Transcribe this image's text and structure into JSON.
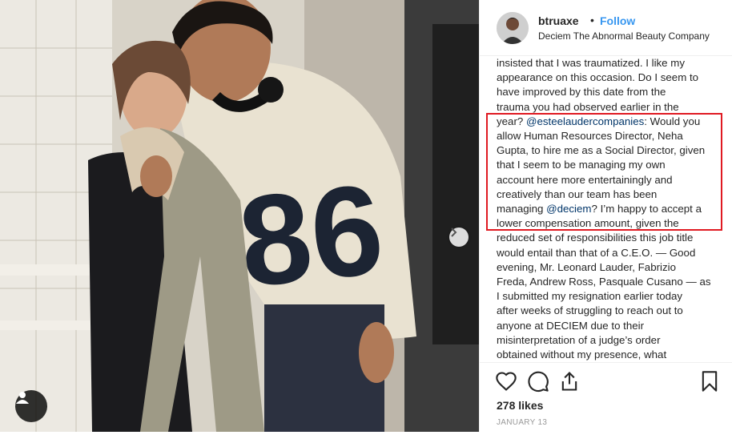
{
  "photo": {
    "alt_icons": {
      "next": "chevron-right-icon",
      "tag": "user-tag-icon"
    }
  },
  "header": {
    "username": "btruaxe",
    "separator": "•",
    "follow_label": "Follow",
    "location": "Deciem The Abnormal Beauty Company"
  },
  "caption": {
    "lines": [
      [
        {
          "t": "insisted that I was traumatized. I like my"
        }
      ],
      [
        {
          "t": "appearance on this occasion. Do I seem to"
        }
      ],
      [
        {
          "t": "have improved by this date from the"
        }
      ],
      [
        {
          "t": "trauma you had observed earlier in the"
        }
      ],
      [
        {
          "t": "year? "
        },
        {
          "t": "@esteelaudercompanies",
          "m": true
        },
        {
          "t": ": Would you"
        }
      ],
      [
        {
          "t": "allow Human Resources Director, Neha"
        }
      ],
      [
        {
          "t": "Gupta, to hire me as a Social Director, given"
        }
      ],
      [
        {
          "t": "that I seem to be managing my own"
        }
      ],
      [
        {
          "t": "account here more entertainingly and"
        }
      ],
      [
        {
          "t": "creatively than our team has been"
        }
      ],
      [
        {
          "t": "managing "
        },
        {
          "t": "@deciem",
          "m": true
        },
        {
          "t": "? I’m happy to accept a"
        }
      ],
      [
        {
          "t": "lower compensation amount, given the"
        }
      ],
      [
        {
          "t": "reduced set of responsibilities this job title"
        }
      ],
      [
        {
          "t": "would entail than that of a C.E.O. — Good"
        }
      ],
      [
        {
          "t": "evening, Mr. Leonard Lauder, Fabrizio"
        }
      ],
      [
        {
          "t": "Freda, Andrew Ross, Pasquale Cusano — as"
        }
      ],
      [
        {
          "t": "I submitted my resignation earlier today"
        }
      ],
      [
        {
          "t": "after weeks of struggling to reach out to"
        }
      ],
      [
        {
          "t": "anyone at DECIEM due to their"
        }
      ],
      [
        {
          "t": "misinterpretation of a judge’s order"
        }
      ],
      [
        {
          "t": "obtained without my presence, what"
        }
      ]
    ]
  },
  "actions": {
    "likes": "278 likes",
    "date": "JANUARY 13",
    "icons": [
      "heart-icon",
      "comment-icon",
      "share-icon",
      "bookmark-icon"
    ]
  },
  "colors": {
    "accent": "#3897f0",
    "mention": "#003569",
    "highlight_box": "#e01a22",
    "muted": "#999999"
  }
}
